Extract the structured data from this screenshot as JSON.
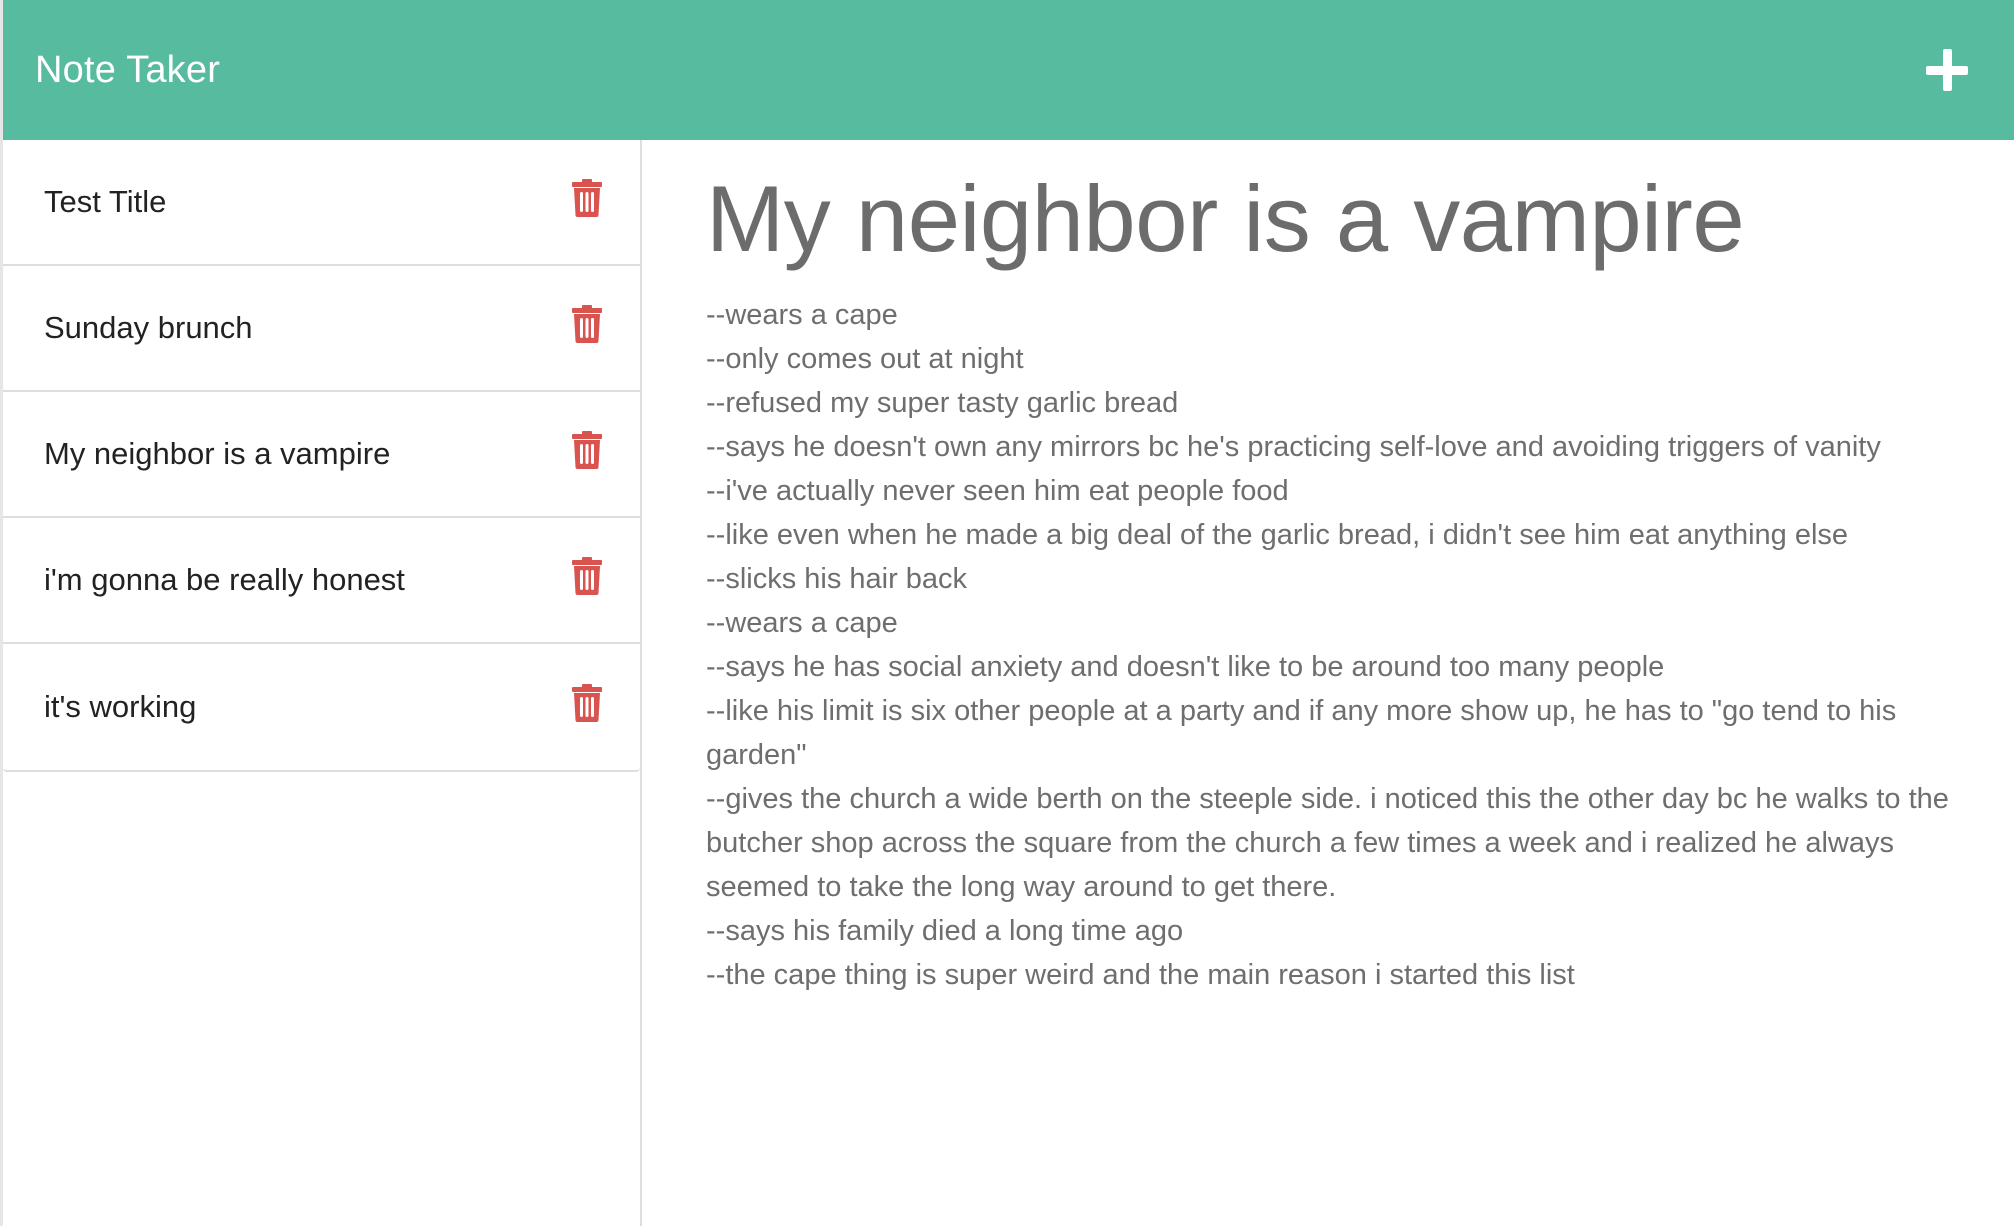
{
  "navbar": {
    "brand": "Note Taker",
    "new_note_icon": "plus-icon"
  },
  "colors": {
    "navbar_bg": "#57bb9f",
    "trash": "#d9534f",
    "heading": "#6c6c6c",
    "body_text": "#6e6e6e"
  },
  "sidebar": {
    "notes": [
      {
        "title": "Test Title",
        "icon": "trash-icon"
      },
      {
        "title": "Sunday brunch",
        "icon": "trash-icon"
      },
      {
        "title": "My neighbor is a vampire",
        "icon": "trash-icon"
      },
      {
        "title": "i'm gonna be really honest",
        "icon": "trash-icon"
      },
      {
        "title": "it's working",
        "icon": "trash-icon"
      }
    ]
  },
  "active_note": {
    "title": "My neighbor is a vampire",
    "text": "--wears a cape\n--only comes out at night\n--refused my super tasty garlic bread\n--says he doesn't own any mirrors bc he's practicing self-love and avoiding triggers of vanity\n--i've actually never seen him eat people food\n--like even when he made a big deal of the garlic bread, i didn't see him eat anything else\n--slicks his hair back\n--wears a cape\n--says he has social anxiety and doesn't like to be around too many people\n--like his limit is six other people at a party and if any more show up, he has to \"go tend to his garden\"\n--gives the church a wide berth on the steeple side. i noticed this the other day bc he walks to the butcher shop across the square from the church a few times a week and i realized he always seemed to take the long way around to get there.\n--says his family died a long time ago\n--the cape thing is super weird and the main reason i started this list"
  }
}
